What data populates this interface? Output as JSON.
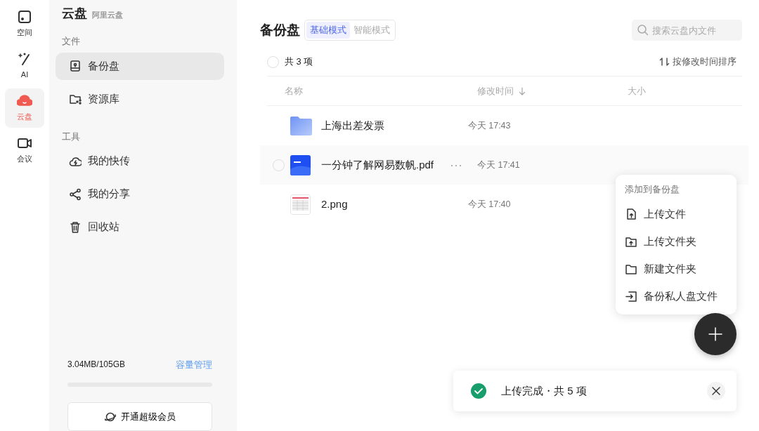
{
  "rail": [
    {
      "label": "空间",
      "selected": false
    },
    {
      "label": "AI",
      "selected": false
    },
    {
      "label": "云盘",
      "selected": true
    },
    {
      "label": "会议",
      "selected": false
    }
  ],
  "sidebar": {
    "title": "云盘",
    "subtitle": "阿里云盘",
    "sections": [
      {
        "heading": "文件",
        "items": [
          {
            "label": "备份盘",
            "selected": true
          },
          {
            "label": "资源库",
            "selected": false
          }
        ]
      },
      {
        "heading": "工具",
        "items": [
          {
            "label": "我的快传",
            "selected": false
          },
          {
            "label": "我的分享",
            "selected": false
          },
          {
            "label": "回收站",
            "selected": false
          }
        ]
      }
    ],
    "storage": {
      "usage": "3.04MB/105GB",
      "manage_link": "容量管理",
      "level": 0
    },
    "vip_button": "开通超级会员"
  },
  "main": {
    "title": "备份盘",
    "modes": [
      {
        "label": "基础模式",
        "selected": true
      },
      {
        "label": "智能模式",
        "selected": false
      }
    ],
    "search": {
      "placeholder": "搜索云盘内文件"
    },
    "all_checked": false,
    "count": "共 3 项",
    "sort_button": "按修改时间排序",
    "columns": [
      "名称",
      "修改时间",
      "大小"
    ],
    "rows": [
      {
        "kind": "folder",
        "name": "上海出差发票",
        "modified": "今天 17:43",
        "hovered": false,
        "checked": false
      },
      {
        "kind": "pdf",
        "name": "一分钟了解网易数帆.pdf",
        "modified": "今天 17:41",
        "hovered": true,
        "checked": false
      },
      {
        "kind": "image",
        "name": "2.png",
        "modified": "今天 17:40",
        "hovered": false,
        "checked": false
      }
    ]
  },
  "add_menu": {
    "heading": "添加到备份盘",
    "items": [
      {
        "label": "上传文件"
      },
      {
        "label": "上传文件夹"
      },
      {
        "label": "新建文件夹"
      },
      {
        "label": "备份私人盘文件"
      }
    ]
  },
  "toast": {
    "message": "上传完成・共 5 项"
  }
}
